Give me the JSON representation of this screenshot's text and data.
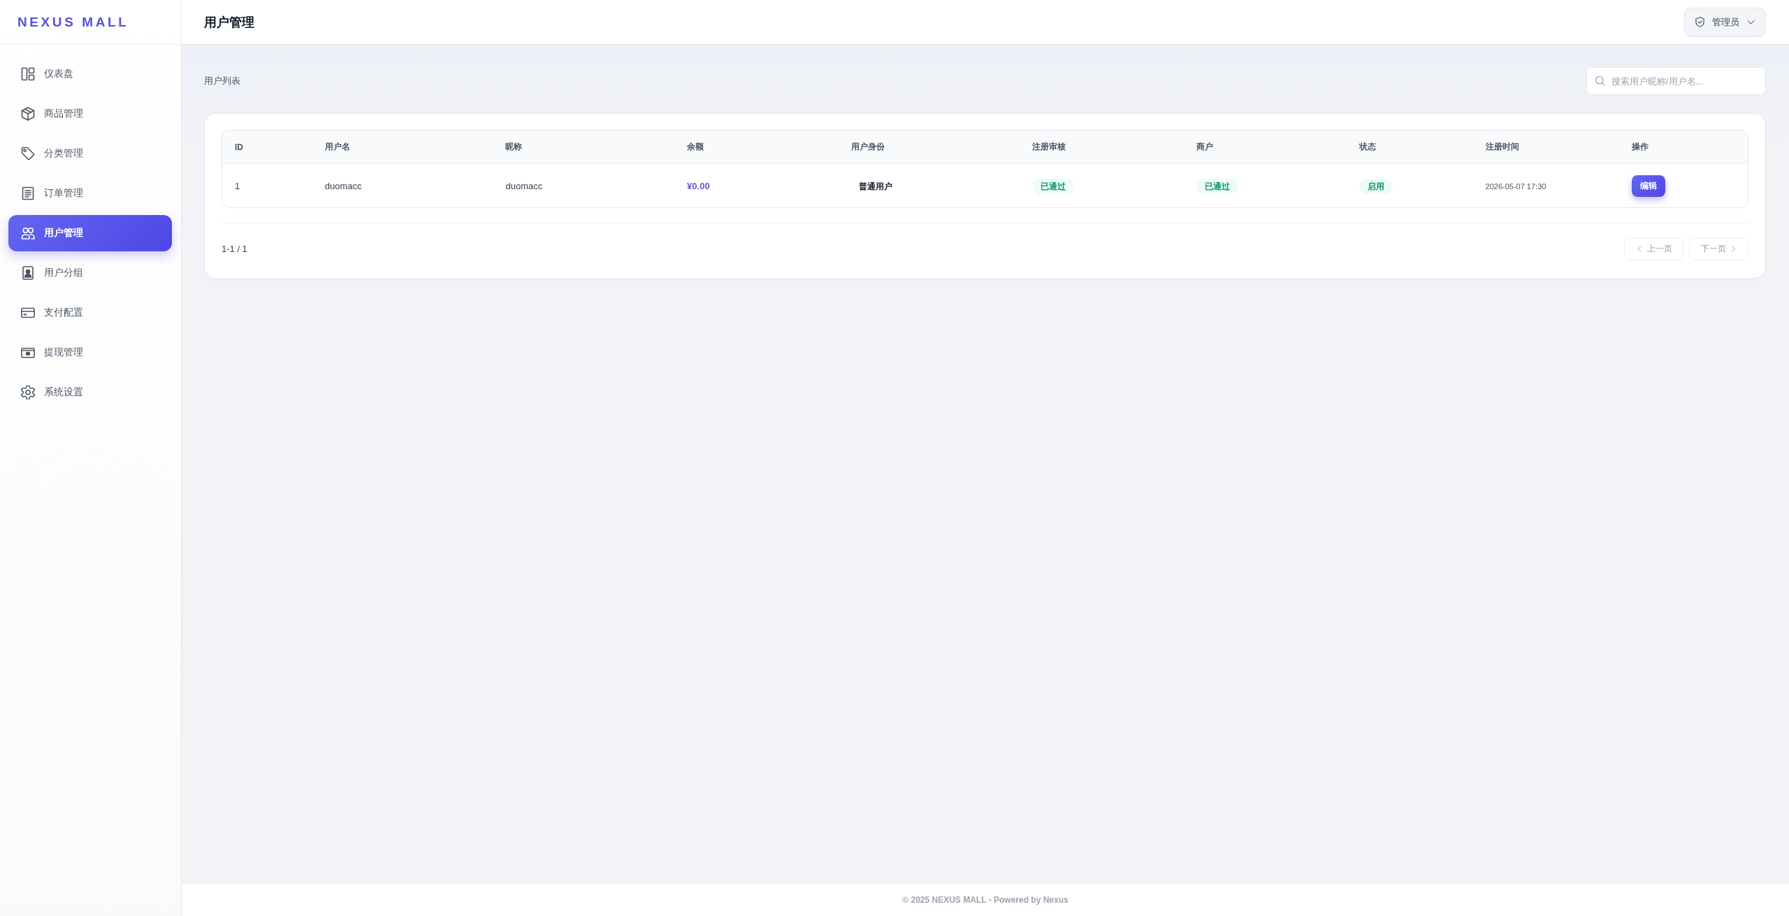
{
  "sidebar": {
    "logo": "NEXUS MALL",
    "items": [
      {
        "label": "仪表盘",
        "selected": false
      },
      {
        "label": "商品管理",
        "selected": false
      },
      {
        "label": "分类管理",
        "selected": false
      },
      {
        "label": "订单管理",
        "selected": false
      },
      {
        "label": "用户管理",
        "selected": true
      },
      {
        "label": "用户分组",
        "selected": false
      },
      {
        "label": "支付配置",
        "selected": false
      },
      {
        "label": "提现管理",
        "selected": false
      },
      {
        "label": "系统设置",
        "selected": false
      }
    ]
  },
  "header": {
    "title": "用户管理",
    "user_menu": {
      "label": "管理员"
    }
  },
  "toolbar": {
    "section_title": "用户列表",
    "search": {
      "placeholder": "搜索用户昵称/用户名..."
    }
  },
  "table": {
    "columns": [
      "ID",
      "用户名",
      "昵称",
      "余额",
      "用户身份",
      "注册审核",
      "商户",
      "状态",
      "注册时间",
      "操作"
    ],
    "rows": [
      {
        "cells": [
          {
            "kind": "text",
            "text": "1"
          },
          {
            "kind": "text",
            "text": "duomacc"
          },
          {
            "kind": "text",
            "text": "duomacc"
          },
          {
            "kind": "amount",
            "text": "¥0.00"
          },
          {
            "kind": "role",
            "text": "普通用户"
          },
          {
            "kind": "badge",
            "text": "已通过"
          },
          {
            "kind": "badge",
            "text": "已通过"
          },
          {
            "kind": "badge",
            "text": "启用"
          },
          {
            "kind": "date",
            "text": "2026-05-07 17:30"
          },
          {
            "kind": "button",
            "text": "编辑"
          }
        ]
      }
    ]
  },
  "pagination": {
    "summary": "1-1 / 1",
    "buttons": [
      {
        "kind": "prev",
        "label": "上一页",
        "disabled": true
      },
      {
        "kind": "next",
        "label": "下一页",
        "disabled": true
      }
    ]
  },
  "footer": {
    "text": "© 2025 NEXUS MALL - Powered by Nexus"
  }
}
